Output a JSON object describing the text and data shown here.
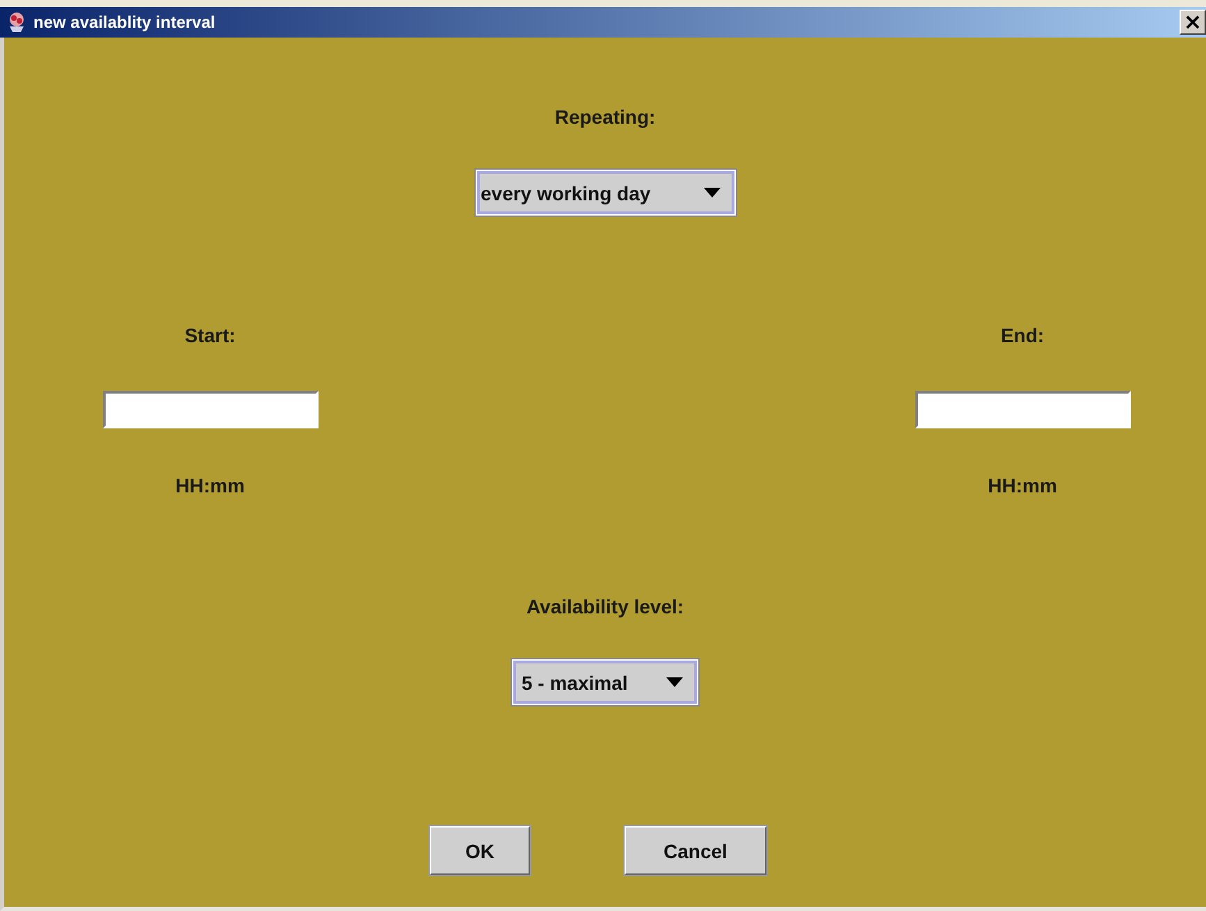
{
  "window": {
    "title": "new availablity interval",
    "close": "×"
  },
  "repeating": {
    "label": "Repeating:",
    "value": "every working day"
  },
  "start": {
    "label": "Start:",
    "format": "HH:mm"
  },
  "end": {
    "label": "End:",
    "format": "HH:mm"
  },
  "availability": {
    "label": "Availability level:",
    "value": "5 - maximal"
  },
  "buttons": [
    "OK",
    "Cancel"
  ]
}
